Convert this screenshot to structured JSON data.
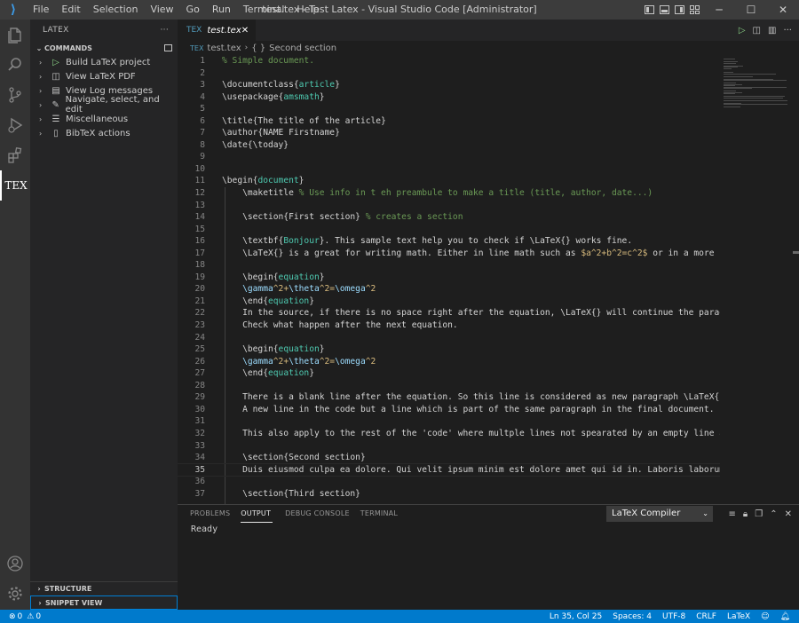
{
  "window": {
    "title": "test.tex - Test Latex - Visual Studio Code [Administrator]",
    "menu": [
      "File",
      "Edit",
      "Selection",
      "View",
      "Go",
      "Run",
      "Terminal",
      "Help"
    ]
  },
  "colors": {
    "accent": "#007acc",
    "background": "#1e1e1e",
    "sidebar": "#252526",
    "titlebar": "#3c3c3c",
    "activitybar": "#333333"
  },
  "activity_bar": {
    "icons": [
      "explorer-icon",
      "search-icon",
      "source-control-icon",
      "run-debug-icon",
      "extensions-icon",
      "tex-icon",
      "account-icon",
      "settings-gear-icon"
    ],
    "tex_label": "TEX"
  },
  "sidebar": {
    "title": "LATEX",
    "more": "···",
    "commands_header": "COMMANDS",
    "items": [
      {
        "label": "Build LaTeX project",
        "icon": "play-icon"
      },
      {
        "label": "View LaTeX PDF",
        "icon": "preview-icon"
      },
      {
        "label": "View Log messages",
        "icon": "log-icon"
      },
      {
        "label": "Navigate, select, and edit",
        "icon": "edit-icon"
      },
      {
        "label": "Miscellaneous",
        "icon": "list-icon"
      },
      {
        "label": "BibTeX actions",
        "icon": "book-icon"
      }
    ],
    "structure": "STRUCTURE",
    "snippet_view": "SNIPPET VIEW"
  },
  "editor": {
    "tab_label": "test.tex",
    "breadcrumb": {
      "file": "test.tex",
      "symbol_icon": "{ }",
      "section": "Second section"
    },
    "current_line": 35
  },
  "code_lines": [
    {
      "n": "1",
      "s": [
        [
          "c-com",
          "% Simple document."
        ]
      ]
    },
    {
      "n": "2",
      "s": []
    },
    {
      "n": "3",
      "s": [
        [
          "c-cmd",
          "\\documentclass"
        ],
        [
          "c-cmd",
          "{"
        ],
        [
          "c-arg",
          "article"
        ],
        [
          "c-cmd",
          "}"
        ]
      ]
    },
    {
      "n": "4",
      "s": [
        [
          "c-cmd",
          "\\usepackage"
        ],
        [
          "c-cmd",
          "{"
        ],
        [
          "c-arg",
          "amsmath"
        ],
        [
          "c-cmd",
          "}"
        ]
      ]
    },
    {
      "n": "5",
      "s": []
    },
    {
      "n": "6",
      "s": [
        [
          "c-cmd",
          "\\title{The title of the article}"
        ]
      ]
    },
    {
      "n": "7",
      "s": [
        [
          "c-cmd",
          "\\author{NAME Firstname}"
        ]
      ]
    },
    {
      "n": "8",
      "s": [
        [
          "c-cmd",
          "\\date{\\today}"
        ]
      ]
    },
    {
      "n": "9",
      "s": []
    },
    {
      "n": "10",
      "s": []
    },
    {
      "n": "11",
      "s": [
        [
          "c-cmd",
          "\\begin"
        ],
        [
          "c-cmd",
          "{"
        ],
        [
          "c-arg",
          "document"
        ],
        [
          "c-cmd",
          "}"
        ]
      ]
    },
    {
      "n": "12",
      "s": [
        [
          "c-cmd",
          "    \\maketitle "
        ],
        [
          "c-com",
          "% Use info in t eh preambule to make a title (title, author, date...)"
        ]
      ]
    },
    {
      "n": "13",
      "s": []
    },
    {
      "n": "14",
      "s": [
        [
          "c-cmd",
          "    \\section{First section} "
        ],
        [
          "c-com",
          "% creates a section"
        ]
      ]
    },
    {
      "n": "15",
      "s": []
    },
    {
      "n": "16",
      "s": [
        [
          "c-cmd",
          "    \\textbf"
        ],
        [
          "c-cmd",
          "{"
        ],
        [
          "c-arg",
          "Bonjour"
        ],
        [
          "c-cmd",
          "}. This sample text help you to check if \\LaTeX{} works fine."
        ]
      ]
    },
    {
      "n": "17",
      "s": [
        [
          "c-cmd",
          "    \\LaTeX{} is a great for writing math. Either in line math such as "
        ],
        [
          "c-math",
          "$a^2+b^2=c^2$"
        ],
        [
          "c-cmd",
          " or in a more 'clas"
        ]
      ]
    },
    {
      "n": "18",
      "s": []
    },
    {
      "n": "19",
      "s": [
        [
          "c-cmd",
          "    \\begin"
        ],
        [
          "c-cmd",
          "{"
        ],
        [
          "c-arg",
          "equation"
        ],
        [
          "c-cmd",
          "}"
        ]
      ]
    },
    {
      "n": "20",
      "s": [
        [
          "c-grk",
          "    \\gamma"
        ],
        [
          "c-math",
          "^2+"
        ],
        [
          "c-grk",
          "\\theta"
        ],
        [
          "c-math",
          "^2="
        ],
        [
          "c-grk",
          "\\omega"
        ],
        [
          "c-math",
          "^2"
        ]
      ]
    },
    {
      "n": "21",
      "s": [
        [
          "c-cmd",
          "    \\end"
        ],
        [
          "c-cmd",
          "{"
        ],
        [
          "c-arg",
          "equation"
        ],
        [
          "c-cmd",
          "}"
        ]
      ]
    },
    {
      "n": "22",
      "s": [
        [
          "c-cmd",
          "    In the source, if there is no space right after the equation, \\LaTeX{} will continue the paragraph"
        ]
      ]
    },
    {
      "n": "23",
      "s": [
        [
          "c-cmd",
          "    Check what happen after the next equation."
        ]
      ]
    },
    {
      "n": "24",
      "s": []
    },
    {
      "n": "25",
      "s": [
        [
          "c-cmd",
          "    \\begin"
        ],
        [
          "c-cmd",
          "{"
        ],
        [
          "c-arg",
          "equation"
        ],
        [
          "c-cmd",
          "}"
        ]
      ]
    },
    {
      "n": "26",
      "s": [
        [
          "c-grk",
          "    \\gamma"
        ],
        [
          "c-math",
          "^2+"
        ],
        [
          "c-grk",
          "\\theta"
        ],
        [
          "c-math",
          "^2="
        ],
        [
          "c-grk",
          "\\omega"
        ],
        [
          "c-math",
          "^2"
        ]
      ]
    },
    {
      "n": "27",
      "s": [
        [
          "c-cmd",
          "    \\end"
        ],
        [
          "c-cmd",
          "{"
        ],
        [
          "c-arg",
          "equation"
        ],
        [
          "c-cmd",
          "}"
        ]
      ]
    },
    {
      "n": "28",
      "s": []
    },
    {
      "n": "29",
      "s": [
        [
          "c-cmd",
          "    There is a blank line after the equation. So this line is considered as new paragraph \\LaTeX{}."
        ]
      ]
    },
    {
      "n": "30",
      "s": [
        [
          "c-cmd",
          "    A new line in the code but a line which is part of the same paragraph in the final document."
        ]
      ]
    },
    {
      "n": "31",
      "s": []
    },
    {
      "n": "32",
      "s": [
        [
          "c-cmd",
          "    This also apply to the rest of the 'code' where multple lines not spearated by an empty line are co"
        ]
      ]
    },
    {
      "n": "33",
      "s": []
    },
    {
      "n": "34",
      "s": [
        [
          "c-cmd",
          "    \\section{Second section}"
        ]
      ]
    },
    {
      "n": "35",
      "s": [
        [
          "c-cmd",
          "    Duis eiusmod culpa ea dolore. Qui velit ipsum minim est dolore amet qui id in. Laboris laborum do r"
        ]
      ]
    },
    {
      "n": "36",
      "s": []
    },
    {
      "n": "37",
      "s": [
        [
          "c-cmd",
          "    \\section{Third section}"
        ]
      ]
    }
  ],
  "panel": {
    "tabs": [
      "PROBLEMS",
      "OUTPUT",
      "DEBUG CONSOLE",
      "TERMINAL"
    ],
    "active_tab": "OUTPUT",
    "channel": "LaTeX Compiler",
    "output_text": "Ready"
  },
  "statusbar": {
    "errors": "0",
    "warnings": "0",
    "position": "Ln 35, Col 25",
    "spaces": "Spaces: 4",
    "encoding": "UTF-8",
    "eol": "CRLF",
    "language": "LaTeX"
  }
}
